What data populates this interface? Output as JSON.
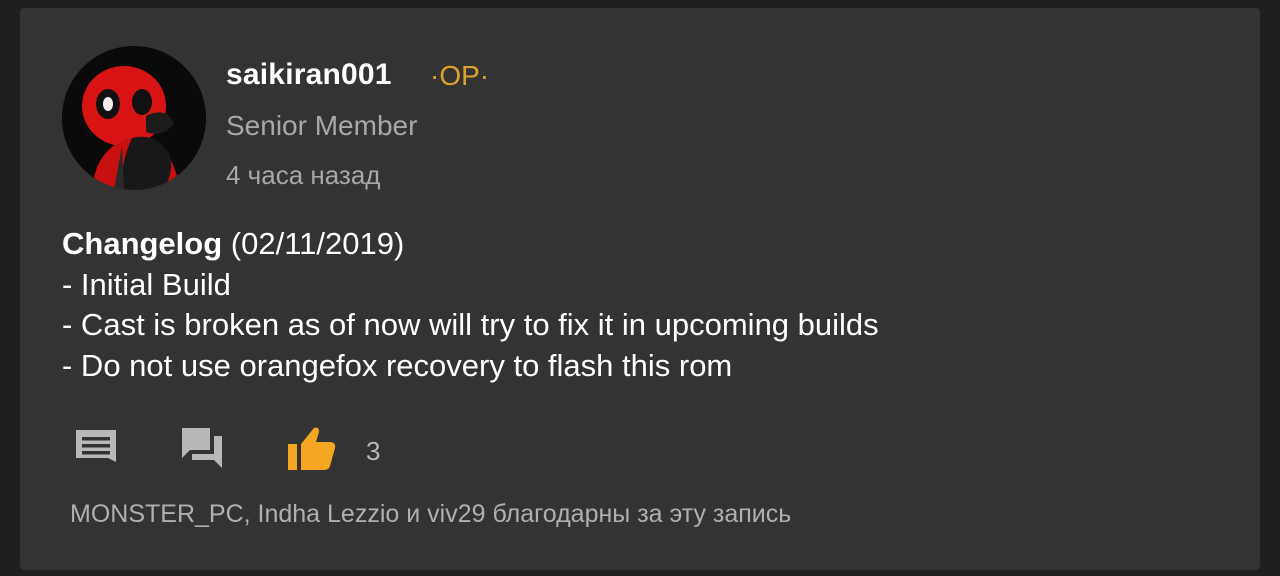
{
  "post": {
    "author": {
      "username": "saikiran001",
      "op_badge": "·OP·",
      "title": "Senior Member",
      "avatar_icon": "deadpool-avatar-icon"
    },
    "time": "4 часа назад",
    "body": {
      "heading_bold": "Changelog",
      "heading_rest": " (02/11/2019)",
      "lines": [
        "- Initial Build",
        "- Cast is broken as of now will try to fix it in upcoming builds",
        "- Do not use orangefox recovery to flash this rom"
      ]
    },
    "actions": {
      "comment_icon": "comment-icon",
      "quote_icon": "reply-chat-icon",
      "like_icon": "thumbs-up-icon",
      "like_count": "3"
    },
    "thanks_text": "MONSTER_PC, Indha Lezzio и viv29 благодарны за эту запись"
  },
  "colors": {
    "background": "#1f1f1f",
    "card": "#333333",
    "text": "#ffffff",
    "muted": "#a8a8a8",
    "op_accent": "#e0a32a",
    "like_accent": "#f5a623",
    "icon_gray": "#b8b8b8"
  }
}
